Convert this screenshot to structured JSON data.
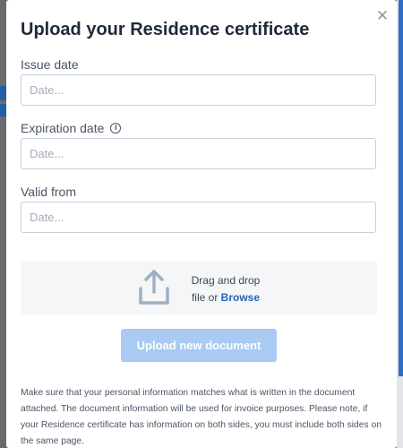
{
  "modal": {
    "title": "Upload your Residence certificate",
    "close_glyph": "✕"
  },
  "fields": [
    {
      "label": "Issue date",
      "placeholder": "Date...",
      "has_info": false
    },
    {
      "label": "Expiration date",
      "placeholder": "Date...",
      "has_info": true
    },
    {
      "label": "Valid from",
      "placeholder": "Date...",
      "has_info": false
    }
  ],
  "info_glyph": "i",
  "dropzone": {
    "line1": "Drag and drop",
    "line2_prefix": "file or ",
    "browse_label": "Browse",
    "icon": "upload-icon"
  },
  "upload_button": {
    "label": "Upload new document"
  },
  "note": "Make sure that your personal information matches what is written in the document attached. The document information will be used for invoice purposes. Please note, if your Residence certificate has information on both sides, you must include both sides on the same page.",
  "colors": {
    "title": "#1f2a3a",
    "link": "#2064b8",
    "button_disabled": "#a9cbf3",
    "dropzone_bg": "#f5f6f8"
  }
}
